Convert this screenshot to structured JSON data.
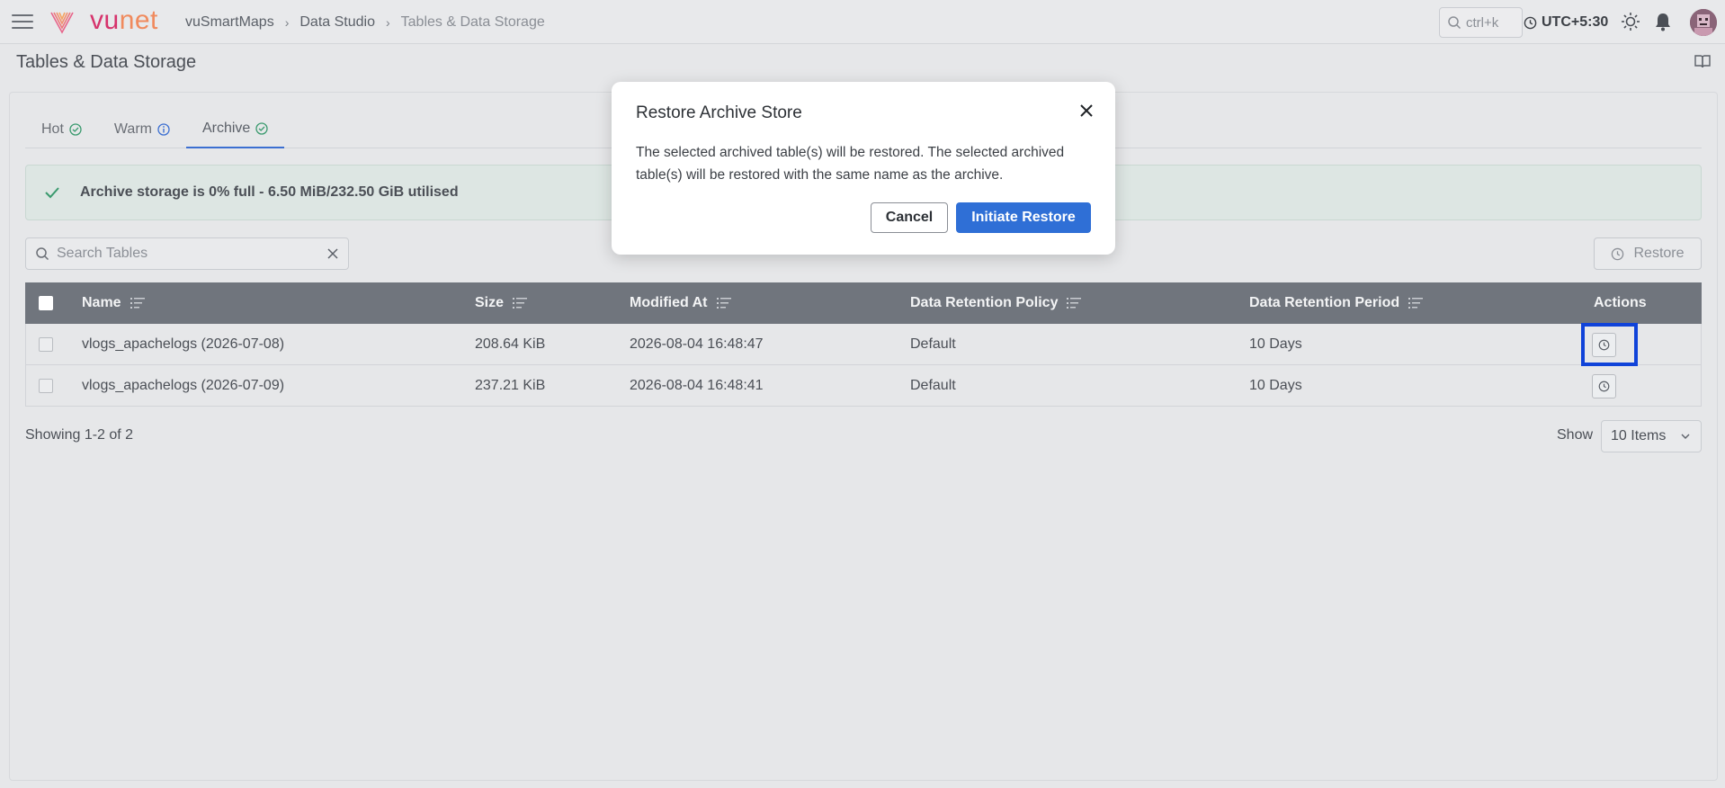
{
  "app": {
    "logo_vu": "vu",
    "logo_net": "net",
    "breadcrumbs": [
      "vuSmartMaps",
      "Data Studio",
      "Tables & Data Storage"
    ],
    "search_shortcut": "ctrl+k",
    "timezone": "UTC+5:30",
    "icons": [
      "menu-icon",
      "search-icon",
      "clock-icon",
      "sun-icon",
      "bell-icon",
      "avatar",
      "book-icon"
    ]
  },
  "page": {
    "title": "Tables & Data Storage"
  },
  "tabs": [
    {
      "label": "Hot",
      "icon": "check-circle-icon",
      "active": false
    },
    {
      "label": "Warm",
      "icon": "info-circle-icon",
      "active": false
    },
    {
      "label": "Archive",
      "icon": "check-circle-icon",
      "active": true
    }
  ],
  "alert": {
    "text": "Archive storage is 0% full - 6.50 MiB/232.50 GiB utilised",
    "color": "#dde6e3"
  },
  "search": {
    "placeholder": "Search Tables",
    "value": ""
  },
  "toolbar": {
    "restore_label": "Restore"
  },
  "table": {
    "columns": [
      "Name",
      "Size",
      "Modified At",
      "Data Retention Policy",
      "Data Retention Period",
      "Actions"
    ],
    "rows": [
      {
        "name": "vlogs_apachelogs (2026-07-08)",
        "size": "208.64 KiB",
        "modified": "2026-08-04 16:48:47",
        "policy": "Default",
        "period": "10 Days"
      },
      {
        "name": "vlogs_apachelogs (2026-07-09)",
        "size": "237.21 KiB",
        "modified": "2026-08-04 16:48:41",
        "policy": "Default",
        "period": "10 Days"
      }
    ]
  },
  "pagination": {
    "showing": "Showing 1-2 of 2",
    "show_label": "Show",
    "page_size": "10 Items"
  },
  "modal": {
    "title": "Restore Archive Store",
    "body": "The selected archived table(s) will be restored. The selected archived table(s) will be restored with the same name as the archive.",
    "cancel_label": "Cancel",
    "confirm_label": "Initiate Restore",
    "confirm_color": "#2f6fd6"
  }
}
